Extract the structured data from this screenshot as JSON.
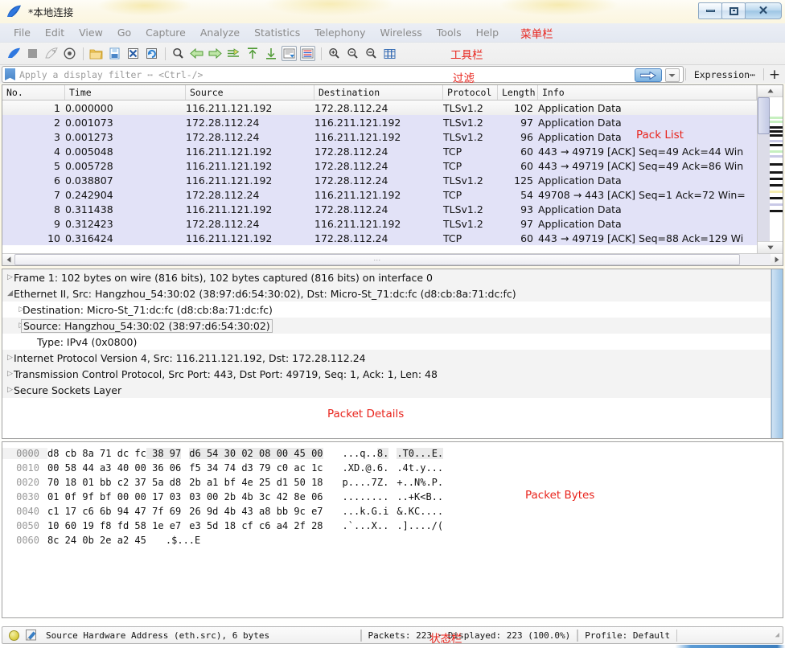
{
  "window": {
    "title": "*本地连接",
    "app_icon": "wireshark-shark-fin-icon",
    "minimize_label": "",
    "maximize_label": "",
    "close_label": "✕"
  },
  "menubar": {
    "items": [
      "File",
      "Edit",
      "View",
      "Go",
      "Capture",
      "Analyze",
      "Statistics",
      "Telephony",
      "Wireless",
      "Tools",
      "Help"
    ],
    "annotation": "菜单栏"
  },
  "toolbar": {
    "annotation": "工具栏",
    "buttons": [
      {
        "name": "start-capture-icon",
        "title": "Start capturing packets"
      },
      {
        "name": "stop-capture-icon",
        "title": "Stop capturing packets"
      },
      {
        "name": "restart-capture-icon",
        "title": "Restart current capture"
      },
      {
        "name": "capture-options-icon",
        "title": "Capture options"
      },
      {
        "name": "open-file-icon",
        "title": "Open a capture file"
      },
      {
        "name": "save-file-icon",
        "title": "Save this capture file"
      },
      {
        "name": "close-file-icon",
        "title": "Close this capture file"
      },
      {
        "name": "reload-file-icon",
        "title": "Reload this file"
      },
      {
        "name": "find-packet-icon",
        "title": "Find a packet"
      },
      {
        "name": "go-back-icon",
        "title": "Go back in packet history"
      },
      {
        "name": "go-forward-icon",
        "title": "Go forward in packet history"
      },
      {
        "name": "go-to-packet-icon",
        "title": "Go to the packet with number"
      },
      {
        "name": "go-first-packet-icon",
        "title": "Go to the first packet"
      },
      {
        "name": "go-last-packet-icon",
        "title": "Go to the last packet"
      },
      {
        "name": "auto-scroll-icon",
        "title": "Auto scroll in live capture"
      },
      {
        "name": "colorize-icon",
        "title": "Colorize packet list"
      },
      {
        "name": "zoom-in-icon",
        "title": "Zoom in"
      },
      {
        "name": "zoom-out-icon",
        "title": "Zoom out"
      },
      {
        "name": "zoom-reset-icon",
        "title": "Reset zoom level"
      },
      {
        "name": "resize-columns-icon",
        "title": "Resize columns"
      }
    ]
  },
  "filterbar": {
    "placeholder": "Apply a display filter ⋯ <Ctrl-/>",
    "value": "",
    "annotation": "过滤",
    "apply_label": "→",
    "dropdown_label": "▾",
    "expression_label": "Expression⋯",
    "add_label": "+"
  },
  "packet_list": {
    "annotation": "Pack List",
    "columns": [
      "No.",
      "Time",
      "Source",
      "Destination",
      "Protocol",
      "Length",
      "Info"
    ],
    "rows": [
      {
        "no": "1",
        "time": "0.000000",
        "source": "116.211.121.192",
        "destination": "172.28.112.24",
        "protocol": "TLSv1.2",
        "length": "102",
        "info": "Application Data",
        "selected": true
      },
      {
        "no": "2",
        "time": "0.001073",
        "source": "172.28.112.24",
        "destination": "116.211.121.192",
        "protocol": "TLSv1.2",
        "length": "97",
        "info": "Application Data",
        "selected": false
      },
      {
        "no": "3",
        "time": "0.001273",
        "source": "172.28.112.24",
        "destination": "116.211.121.192",
        "protocol": "TLSv1.2",
        "length": "96",
        "info": "Application Data",
        "selected": false
      },
      {
        "no": "4",
        "time": "0.005048",
        "source": "116.211.121.192",
        "destination": "172.28.112.24",
        "protocol": "TCP",
        "length": "60",
        "info": "443 → 49719 [ACK] Seq=49 Ack=44 Win",
        "selected": false
      },
      {
        "no": "5",
        "time": "0.005728",
        "source": "116.211.121.192",
        "destination": "172.28.112.24",
        "protocol": "TCP",
        "length": "60",
        "info": "443 → 49719 [ACK] Seq=49 Ack=86 Win",
        "selected": false
      },
      {
        "no": "6",
        "time": "0.038807",
        "source": "116.211.121.192",
        "destination": "172.28.112.24",
        "protocol": "TLSv1.2",
        "length": "125",
        "info": "Application Data",
        "selected": false
      },
      {
        "no": "7",
        "time": "0.242904",
        "source": "172.28.112.24",
        "destination": "116.211.121.192",
        "protocol": "TCP",
        "length": "54",
        "info": "49708 → 443 [ACK] Seq=1 Ack=72 Win=",
        "selected": false
      },
      {
        "no": "8",
        "time": "0.311438",
        "source": "116.211.121.192",
        "destination": "172.28.112.24",
        "protocol": "TLSv1.2",
        "length": "93",
        "info": "Application Data",
        "selected": false
      },
      {
        "no": "9",
        "time": "0.312423",
        "source": "172.28.112.24",
        "destination": "116.211.121.192",
        "protocol": "TLSv1.2",
        "length": "97",
        "info": "Application Data",
        "selected": false
      },
      {
        "no": "10",
        "time": "0.316424",
        "source": "116.211.121.192",
        "destination": "172.28.112.24",
        "protocol": "TCP",
        "length": "60",
        "info": "443 → 49719 [ACK] Seq=88 Ack=129 Wi",
        "selected": false
      }
    ]
  },
  "packet_details": {
    "annotation": "Packet Details",
    "rows": [
      {
        "indent": 1,
        "twisty": "collapsed",
        "text": "Frame 1: 102 bytes on wire (816 bits), 102 bytes captured (816 bits) on interface 0",
        "shaded": true,
        "boxed": false
      },
      {
        "indent": 1,
        "twisty": "expanded",
        "text": "Ethernet II, Src: Hangzhou_54:30:02 (38:97:d6:54:30:02), Dst: Micro-St_71:dc:fc (d8:cb:8a:71:dc:fc)",
        "shaded": true,
        "boxed": false
      },
      {
        "indent": 2,
        "twisty": "collapsed",
        "text": "Destination: Micro-St_71:dc:fc (d8:cb:8a:71:dc:fc)",
        "shaded": false,
        "boxed": false
      },
      {
        "indent": 2,
        "twisty": "collapsed",
        "text": "Source: Hangzhou_54:30:02 (38:97:d6:54:30:02)",
        "shaded": true,
        "boxed": true
      },
      {
        "indent": 3,
        "twisty": "none",
        "text": "Type: IPv4 (0x0800)",
        "shaded": false,
        "boxed": false
      },
      {
        "indent": 1,
        "twisty": "collapsed",
        "text": "Internet Protocol Version 4, Src: 116.211.121.192, Dst: 172.28.112.24",
        "shaded": true,
        "boxed": false
      },
      {
        "indent": 1,
        "twisty": "collapsed",
        "text": "Transmission Control Protocol, Src Port: 443, Dst Port: 49719, Seq: 1, Ack: 1, Len: 48",
        "shaded": true,
        "boxed": false
      },
      {
        "indent": 1,
        "twisty": "collapsed",
        "text": "Secure Sockets Layer",
        "shaded": true,
        "boxed": false
      }
    ]
  },
  "packet_bytes": {
    "annotation": "Packet Bytes",
    "rows": [
      {
        "offset": "0000",
        "hex_left": "d8 cb 8a 71 dc fc 38 97",
        "hex_right": "d6 54 30 02 08 00 45 00",
        "ascii_left": "...q..8.",
        "ascii_right": ".T0...E.",
        "hl_from": 6
      },
      {
        "offset": "0010",
        "hex_left": "00 58 44 a3 40 00 36 06",
        "hex_right": "f5 34 74 d3 79 c0 ac 1c",
        "ascii_left": ".XD.@.6.",
        "ascii_right": ".4t.y...",
        "hl_from": -1
      },
      {
        "offset": "0020",
        "hex_left": "70 18 01 bb c2 37 5a d8",
        "hex_right": "2b a1 bf 4e 25 d1 50 18",
        "ascii_left": "p....7Z.",
        "ascii_right": "+..N%.P.",
        "hl_from": -1
      },
      {
        "offset": "0030",
        "hex_left": "01 0f 9f bf 00 00 17 03",
        "hex_right": "03 00 2b 4b 3c 42 8e 06",
        "ascii_left": "........",
        "ascii_right": "..+K<B..",
        "hl_from": -1
      },
      {
        "offset": "0040",
        "hex_left": "c1 17 c6 6b 94 47 7f 69",
        "hex_right": "26 9d 4b 43 a8 bb 9c e7",
        "ascii_left": "...k.G.i",
        "ascii_right": "&.KC....",
        "hl_from": -1
      },
      {
        "offset": "0050",
        "hex_left": "10 60 19 f8 fd 58 1e e7",
        "hex_right": "e3 5d 18 cf c6 a4 2f 28",
        "ascii_left": ".`...X..",
        "ascii_right": ".]..../(",
        "hl_from": -1
      },
      {
        "offset": "0060",
        "hex_left": "8c 24 0b 2e a2 45",
        "hex_right": "",
        "ascii_left": ".$...E",
        "ascii_right": "",
        "hl_from": -1
      }
    ]
  },
  "statusbar": {
    "annotation": "状态栏",
    "expert_icon": "expert-info-circle-icon",
    "capture_comment_icon": "capture-file-properties-icon",
    "field_text": "Source Hardware Address (eth.src), 6 bytes",
    "packets_text": "Packets: 223 · Displayed: 223 (100.0%)",
    "profile_text": "Profile: Default"
  },
  "colors": {
    "annotation_red": "#e8241c",
    "row_default_bg": "#e2e2f7",
    "row_selected_bg": "#f3f3f3",
    "menu_text": "#8a8a8a",
    "accent_blue": "#4a86c8"
  }
}
